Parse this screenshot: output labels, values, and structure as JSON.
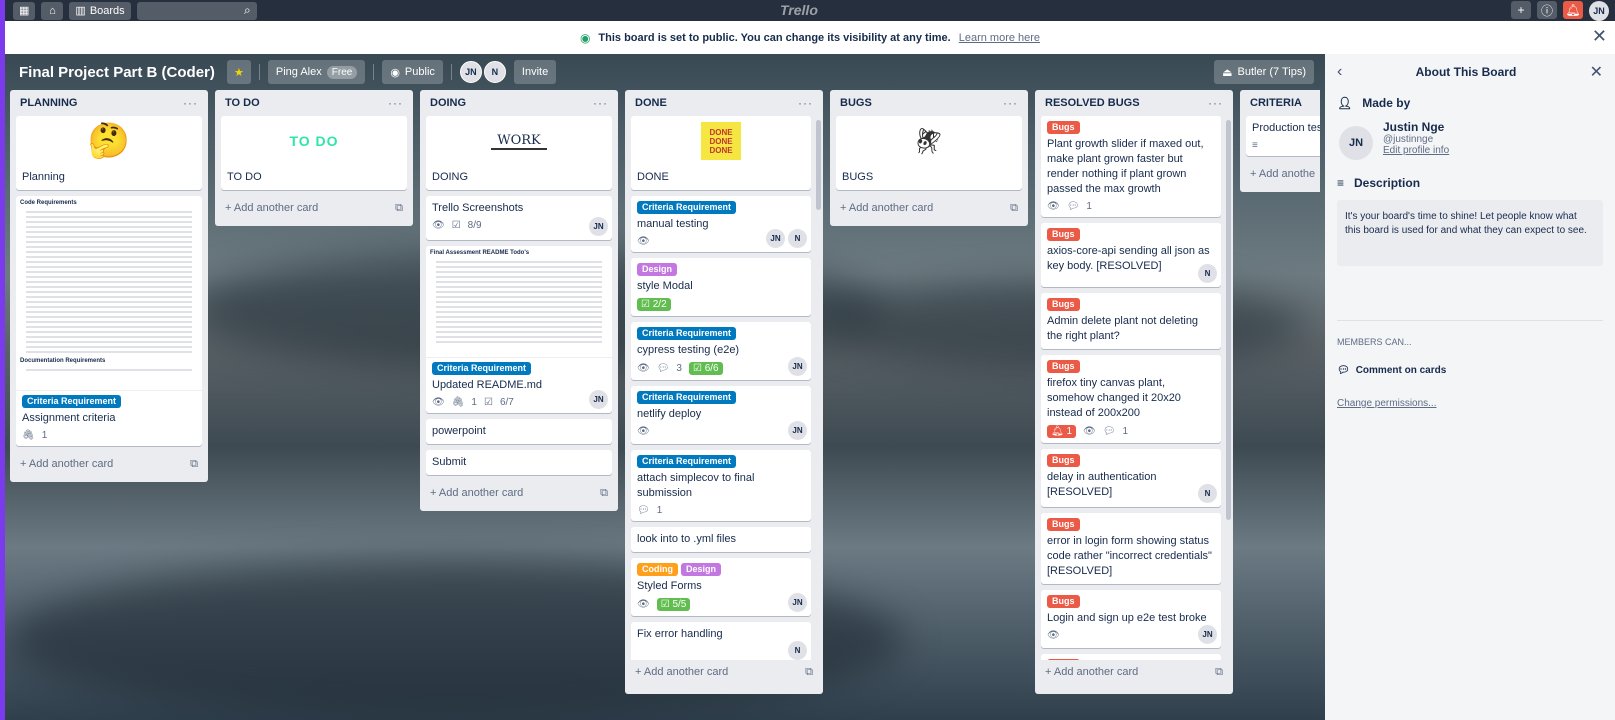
{
  "topbar": {
    "boards_label": "Boards",
    "logo": "Trello"
  },
  "notice": {
    "message": "This board is set to public. You can change its visibility at any time.",
    "link": "Learn more here"
  },
  "header": {
    "title": "Final Project Part B (Coder)",
    "team": "Ping Alex",
    "team_badge": "Free",
    "visibility": "Public",
    "members": [
      "JN",
      "N"
    ],
    "invite": "Invite",
    "butler": "Butler (7 Tips)"
  },
  "lists": {
    "planning": {
      "title": "PLANNING",
      "card_planning": "Planning",
      "label_criteria": "Criteria Requirement",
      "card_assignment": "Assignment criteria",
      "attach_count": "1",
      "doc_title": "Code Requirements",
      "doc_subtitle": "Documentation Requirements",
      "add": "Add another card"
    },
    "todo": {
      "title": "TO DO",
      "cover_text": "TO DO",
      "card_todo": "TO DO",
      "add": "Add another card"
    },
    "doing": {
      "title": "DOING",
      "cover_text": "WORK",
      "card_doing": "DOING",
      "card_screens": "Trello Screenshots",
      "screens_check": "8/9",
      "screens_member": "JN",
      "doc_title": "Final Assessment README Todo's",
      "label_criteria": "Criteria Requirement",
      "card_readme": "Updated README.md",
      "readme_attach": "1",
      "readme_check": "6/7",
      "readme_member": "JN",
      "card_powerpoint": "powerpoint",
      "card_submit": "Submit",
      "add": "Add another card"
    },
    "done": {
      "title": "DONE",
      "cover_text": "DONE DONE DONE",
      "card_done": "DONE",
      "label_criteria": "Criteria Requirement",
      "label_design": "Design",
      "label_coding": "Coding",
      "card_manual": "manual testing",
      "manual_members": [
        "JN",
        "N"
      ],
      "card_modal": "style Modal",
      "modal_check": "2/2",
      "card_cypress": "cypress testing (e2e)",
      "cypress_comments": "3",
      "cypress_check": "6/6",
      "cypress_member": "JN",
      "card_netlify": "netlify deploy",
      "netlify_member": "JN",
      "card_simplecov": "attach simplecov to final submission",
      "simplecov_comments": "1",
      "card_yml": "look into to .yml files",
      "card_forms": "Styled Forms",
      "forms_check": "5/5",
      "forms_member": "JN",
      "card_error": "Fix error handling",
      "error_member": "N",
      "add": "Add another card"
    },
    "bugs": {
      "title": "BUGS",
      "card_bugs": "BUGS",
      "add": "Add another card"
    },
    "resolved": {
      "title": "RESOLVED BUGS",
      "label_bugs": "Bugs",
      "card_1": "Plant growth slider if maxed out, make plant grown faster but render nothing if plant grown passed the max growth",
      "card_1_comments": "1",
      "card_2": "axios-core-api sending all json as key body. [RESOLVED]",
      "card_2_member": "N",
      "card_3": "Admin delete plant not deleting the right plant?",
      "card_4": "firefox tiny canvas plant, somehow changed it 20x20 instead of 200x200",
      "card_4_alert": "1",
      "card_4_comments": "1",
      "card_5": "delay in authentication [RESOLVED]",
      "card_5_member": "N",
      "card_6": "error in login form showing status code rather \"incorrect credentials\" [RESOLVED]",
      "card_7": "Login and sign up e2e test broke",
      "card_7_member": "JN",
      "add": "Add another card"
    },
    "criteria": {
      "title": "CRITERIA",
      "card_1": "Production tes",
      "add": "Add anothe"
    }
  },
  "panel": {
    "title": "About This Board",
    "made_by": "Made by",
    "maker_initials": "JN",
    "maker_name": "Justin Nge",
    "maker_username": "@justinnge",
    "edit_profile": "Edit profile info",
    "description_label": "Description",
    "description": "It's your board's time to shine! Let people know what this board is used for and what they can expect to see.",
    "members_can": "MEMBERS CAN...",
    "comment_on_cards": "Comment on cards",
    "change_permissions": "Change permissions..."
  },
  "colors": {
    "criteria_label": "#0079bf",
    "design_label": "#c377e0",
    "coding_label": "#ff9f1a",
    "bugs_label": "#eb5a46",
    "checklist_done": "#61bd4f",
    "frame_accent": "#7c3aed"
  }
}
